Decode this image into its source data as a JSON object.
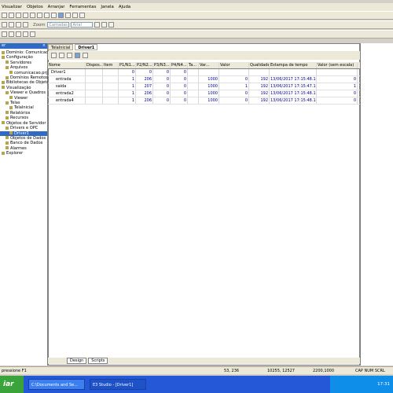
{
  "menu": [
    "Visualizar",
    "Objetos",
    "Arranjar",
    "Ferramentas",
    "Janela",
    "Ajuda"
  ],
  "toolbar": {
    "zoom_label": "Zoom",
    "layer_placeholder": "Camadas",
    "font_placeholder": "Arial"
  },
  "explorer": {
    "title": "er",
    "items": [
      {
        "label": "Domínio: Comunicacao",
        "indent": 0
      },
      {
        "label": "Configuração",
        "indent": 0
      },
      {
        "label": "Servidores",
        "indent": 1
      },
      {
        "label": "Arquivos",
        "indent": 1
      },
      {
        "label": "comunicacao.prj",
        "indent": 2
      },
      {
        "label": "Domínios Remotos",
        "indent": 1
      },
      {
        "label": "Bibliotecas de Objetos",
        "indent": 0
      },
      {
        "label": "Visualização",
        "indent": 0
      },
      {
        "label": "Viewer e Quadros",
        "indent": 1
      },
      {
        "label": "Viewer",
        "indent": 2
      },
      {
        "label": "Telas",
        "indent": 1
      },
      {
        "label": "TelaInicial",
        "indent": 2
      },
      {
        "label": "Relatórios",
        "indent": 1
      },
      {
        "label": "Recursos",
        "indent": 1
      },
      {
        "label": "Objetos de Servidor",
        "indent": 0
      },
      {
        "label": "Drivers e OPC",
        "indent": 1
      },
      {
        "label": "Driver1",
        "indent": 2,
        "selected": true
      },
      {
        "label": "Objetos de Dados",
        "indent": 1
      },
      {
        "label": "Banco de Dados",
        "indent": 1
      },
      {
        "label": "Alarmes",
        "indent": 1
      },
      {
        "label": "Explorer",
        "indent": 0
      }
    ]
  },
  "tabs": [
    "TelaInicial",
    "Driver1"
  ],
  "columns": [
    "Nome",
    "Dispos...",
    "Item",
    "P1/N1...",
    "P2/N2...",
    "P3/N3...",
    "P4/N4...",
    "Ta...",
    "Var...",
    "Valor",
    "Qualidade",
    "Estampa de tempo",
    "Valor (sem escala)"
  ],
  "rows": [
    {
      "name": "Driver1",
      "p1": "0",
      "p2": "0",
      "p3": "0",
      "p4": "0",
      "ta": "",
      "var": "",
      "valor": "",
      "qual": "",
      "time": "",
      "raw": ""
    },
    {
      "name": "entrada",
      "p1": "1",
      "p2": "206",
      "p3": "0",
      "p4": "0",
      "ta": "",
      "var": "1000",
      "valor": "0",
      "qual": "192",
      "time": "13/06/2017 17:15:48.156",
      "raw": "0"
    },
    {
      "name": "saida",
      "p1": "1",
      "p2": "207",
      "p3": "0",
      "p4": "0",
      "ta": "",
      "var": "1000",
      "valor": "1",
      "qual": "192",
      "time": "13/06/2017 17:15:47.125",
      "raw": "1"
    },
    {
      "name": "entrada2",
      "p1": "1",
      "p2": "206",
      "p3": "0",
      "p4": "0",
      "ta": "",
      "var": "1000",
      "valor": "0",
      "qual": "192",
      "time": "13/06/2017 17:15:48.156",
      "raw": "0"
    },
    {
      "name": "entrada4",
      "p1": "1",
      "p2": "206",
      "p3": "0",
      "p4": "0",
      "ta": "",
      "var": "1000",
      "valor": "0",
      "qual": "192",
      "time": "13/06/2017 17:15:48.156",
      "raw": "0"
    }
  ],
  "bottom_tabs": [
    "Design",
    "Scripts"
  ],
  "status": {
    "hint": "pressione F1",
    "coords": "53, 236",
    "size": "10255, 12527",
    "zoom": "2200,1000",
    "flags": "CAP  NUM  SCRL"
  },
  "taskbar": {
    "start": "iar",
    "tasks": [
      "C:\\Documents and Se...",
      "E3 Studio - [Driver1]"
    ],
    "clock": "17:31"
  }
}
